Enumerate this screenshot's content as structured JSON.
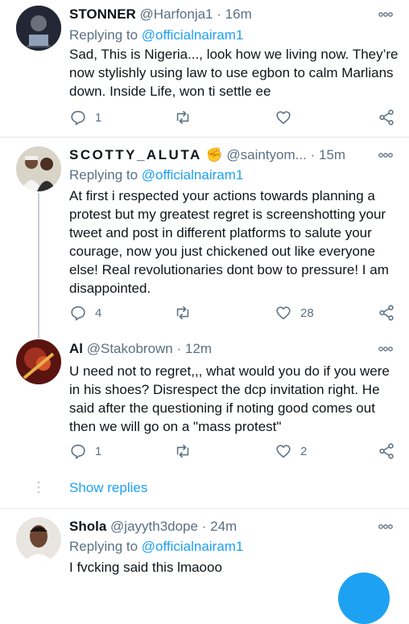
{
  "tweets": [
    {
      "name": "STONNER",
      "handle": "@Harfonja1",
      "sep": "·",
      "time": "16m",
      "replying_prefix": "Replying to ",
      "replying_to": "@officialnairam1",
      "text": "Sad, This is Nigeria..., look how we living now. They’re now stylishly using law to use egbon to calm Marlians down. Inside Life, won ti settle ee",
      "reply_count": "1",
      "retweet_count": "",
      "like_count": ""
    },
    {
      "name": "SCOTTY_ALUTA",
      "name_emoji": "✊",
      "handle": "@saintyom...",
      "sep": "·",
      "time": "15m",
      "replying_prefix": "Replying to ",
      "replying_to": "@officialnairam1",
      "text": "At first i respected your actions towards planning a protest but my greatest regret is screenshotting your tweet and post in different platforms to salute your courage, now you just chickened out like everyone else! Real revolutionaries dont bow to pressure! I am disappointed.",
      "reply_count": "4",
      "retweet_count": "",
      "like_count": "28"
    },
    {
      "name": "Al",
      "handle": "@Stakobrown",
      "sep": "·",
      "time": "12m",
      "text": "U need not to regret,,, what would you do if you were in his shoes? Disrespect the dcp invitation right. He said after the questioning if noting good comes out then we will go on a \"mass protest\"",
      "reply_count": "1",
      "retweet_count": "",
      "like_count": "2"
    },
    {
      "name": "Shola",
      "handle": "@jayyth3dope",
      "sep": "·",
      "time": "24m",
      "replying_prefix": "Replying to ",
      "replying_to": "@officialnairam1",
      "text": "I fvcking said this lmaooo"
    }
  ],
  "show_replies": "Show replies",
  "colors": {
    "accent": "#1da1f2",
    "muted": "#5b7083",
    "text": "#0f1419",
    "divider": "#e1e8ed"
  },
  "icons": [
    "reply-icon",
    "retweet-icon",
    "like-icon",
    "share-icon",
    "more-icon"
  ]
}
